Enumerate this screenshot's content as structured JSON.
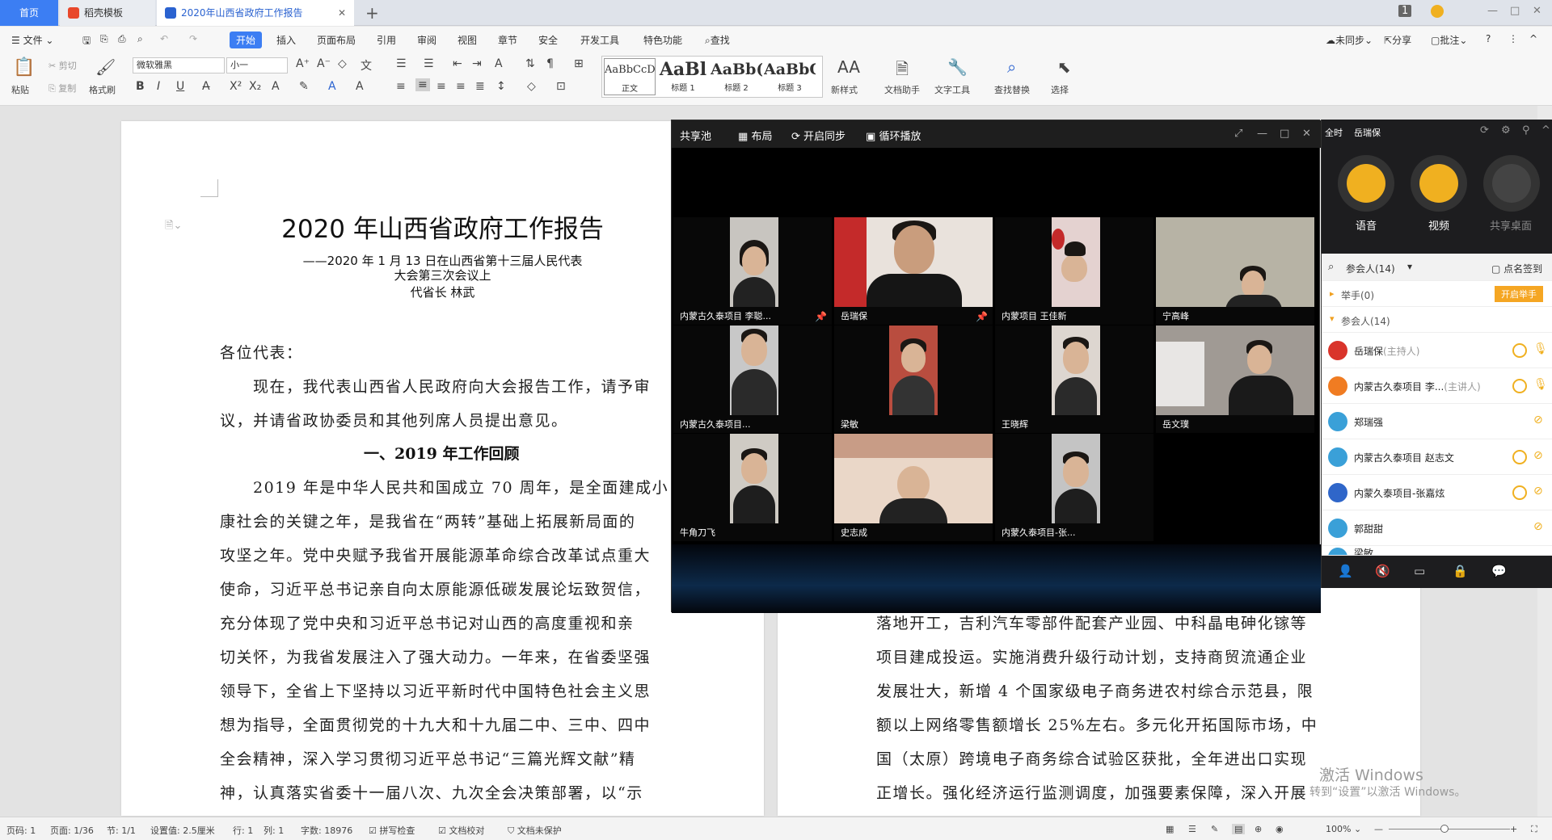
{
  "tabs": {
    "home": "首页",
    "template": "稻壳模板",
    "document": "2020年山西省政府工作报告"
  },
  "menu": {
    "file": "文件",
    "items": [
      "开始",
      "插入",
      "页面布局",
      "引用",
      "审阅",
      "视图",
      "章节",
      "安全",
      "开发工具",
      "特色功能"
    ],
    "search": "查找",
    "sync": "未同步",
    "share": "分享",
    "annotate": "批注"
  },
  "ribbon": {
    "paste": "粘贴",
    "cut": "剪切",
    "copy": "复制",
    "format_painter": "格式刷",
    "font_name": "微软雅黑",
    "font_size": "小一",
    "styles": [
      {
        "preview": "AaBbCcDd",
        "label": "正文"
      },
      {
        "preview": "AaBl",
        "label": "标题 1"
      },
      {
        "preview": "AaBb(",
        "label": "标题 2"
      },
      {
        "preview": "AaBbC",
        "label": "标题 3"
      }
    ],
    "new_style": "新样式",
    "doc_helper": "文档助手",
    "text_tools": "文字工具",
    "find_replace": "查找替换",
    "select": "选择"
  },
  "document": {
    "title": "2020 年山西省政府工作报告",
    "sub1": "——2020 年 1 月 13 日在山西省第十三届人民代表",
    "sub2": "大会第三次会议上",
    "sub3": "代省长  林武",
    "lines_left": [
      "各位代表：",
      "　　现在，我代表山西省人民政府向大会报告工作，请予审",
      "议，并请省政协委员和其他列席人员提出意见。",
      "　　2019 年是中华人民共和国成立 70 周年，是全面建成小",
      "康社会的关键之年，是我省在“两转”基础上拓展新局面的",
      "攻坚之年。党中央赋予我省开展能源革命综合改革试点重大",
      "使命，习近平总书记亲自向太原能源低碳发展论坛致贺信，",
      "充分体现了党中央和习近平总书记对山西的高度重视和亲",
      "切关怀，为我省发展注入了强大动力。一年来，在省委坚强",
      "领导下，全省上下坚持以习近平新时代中国特色社会主义思",
      "想为指导，全面贯彻党的十九大和十九届二中、三中、四中",
      "全会精神，深入学习贯彻习近平总书记“三篇光辉文献”精",
      "神，认真落实省委十一届八次、九次全会决策部署，以“示"
    ],
    "heading": "一、2019 年工作回顾",
    "lines_right": [
      "落地开工，吉利汽车零部件配套产业园、中科晶电砷化镓等",
      "项目建成投运。实施消费升级行动计划，支持商贸流通企业",
      "发展壮大，新增 4 个国家级电子商务进农村综合示范县，限",
      "额以上网络零售额增长 25%左右。多元化开拓国际市场，中",
      "国（太原）跨境电子商务综合试验区获批，全年进出口实现",
      "正增长。强化经济运行监测调度，加强要素保障，深入开展"
    ]
  },
  "meeting": {
    "pool": "共享池",
    "layout": "布局",
    "sync": "开启同步",
    "loop": "循环播放",
    "tiles": [
      "内蒙古久泰项目 李聪...",
      "岳瑞保",
      "内蒙项目 王佳新",
      "宁高峰",
      "内蒙古久泰项目...",
      "梁敏",
      "王晓辉",
      "岳文璞",
      "牛角刀飞",
      "史志成",
      "内蒙久泰项目-张..."
    ],
    "side_title_fullscreen": "全时",
    "side_title_host": "岳瑞保",
    "voice": "语音",
    "video": "视频",
    "share_desktop": "共享桌面",
    "participants_header": "参会人(14)",
    "checkin": "点名签到",
    "raise_hand": "举手(0)",
    "raise_hand_btn": "开启举手",
    "participants_group": "参会人(14)",
    "participants": [
      {
        "name": "岳瑞保",
        "role": "(主持人)",
        "color": "#d9342b"
      },
      {
        "name": "内蒙古久泰项目 李...",
        "role": "(主讲人)",
        "color": "#f07c22"
      },
      {
        "name": "郑瑞强",
        "role": "",
        "color": "#3aa0d8"
      },
      {
        "name": "内蒙古久泰项目 赵志文",
        "role": "",
        "color": "#3aa0d8"
      },
      {
        "name": "内蒙久泰项目-张嘉炫",
        "role": "",
        "color": "#2f66c9"
      },
      {
        "name": "郭甜甜",
        "role": "",
        "color": "#3aa0d8"
      },
      {
        "name": "梁敏",
        "role": "",
        "color": "#3aa0d8"
      }
    ]
  },
  "status": {
    "page_no": "页码: 1",
    "pages": "页面: 1/36",
    "section": "节: 1/1",
    "setting": "设置值: 2.5厘米",
    "row": "行: 1",
    "col": "列: 1",
    "words": "字数: 18976",
    "spell": "拼写检查",
    "proofread": "文档校对",
    "protect": "文档未保护",
    "zoom": "100%"
  },
  "activation": {
    "line1": "激活 Windows",
    "line2": "转到“设置”以激活 Windows。"
  },
  "colors": {
    "accent": "#3c7ef3",
    "meeting_yellow": "#f0b020",
    "raise_btn": "#f5a623"
  }
}
